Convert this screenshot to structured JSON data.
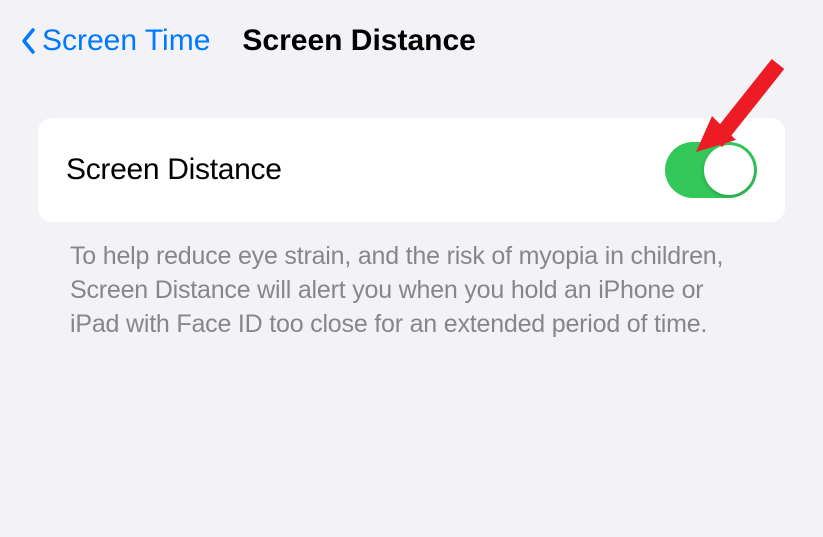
{
  "nav": {
    "back_label": "Screen Time",
    "title": "Screen Distance"
  },
  "setting": {
    "label": "Screen Distance",
    "enabled": true
  },
  "description": "To help reduce eye strain, and the risk of myopia in children, Screen Distance will alert you when you hold an iPhone or iPad with Face ID too close for an extended period of time.",
  "colors": {
    "link": "#007aff",
    "toggle_on": "#34c759",
    "background": "#f2f2f7",
    "annotation": "#ed1c24"
  }
}
